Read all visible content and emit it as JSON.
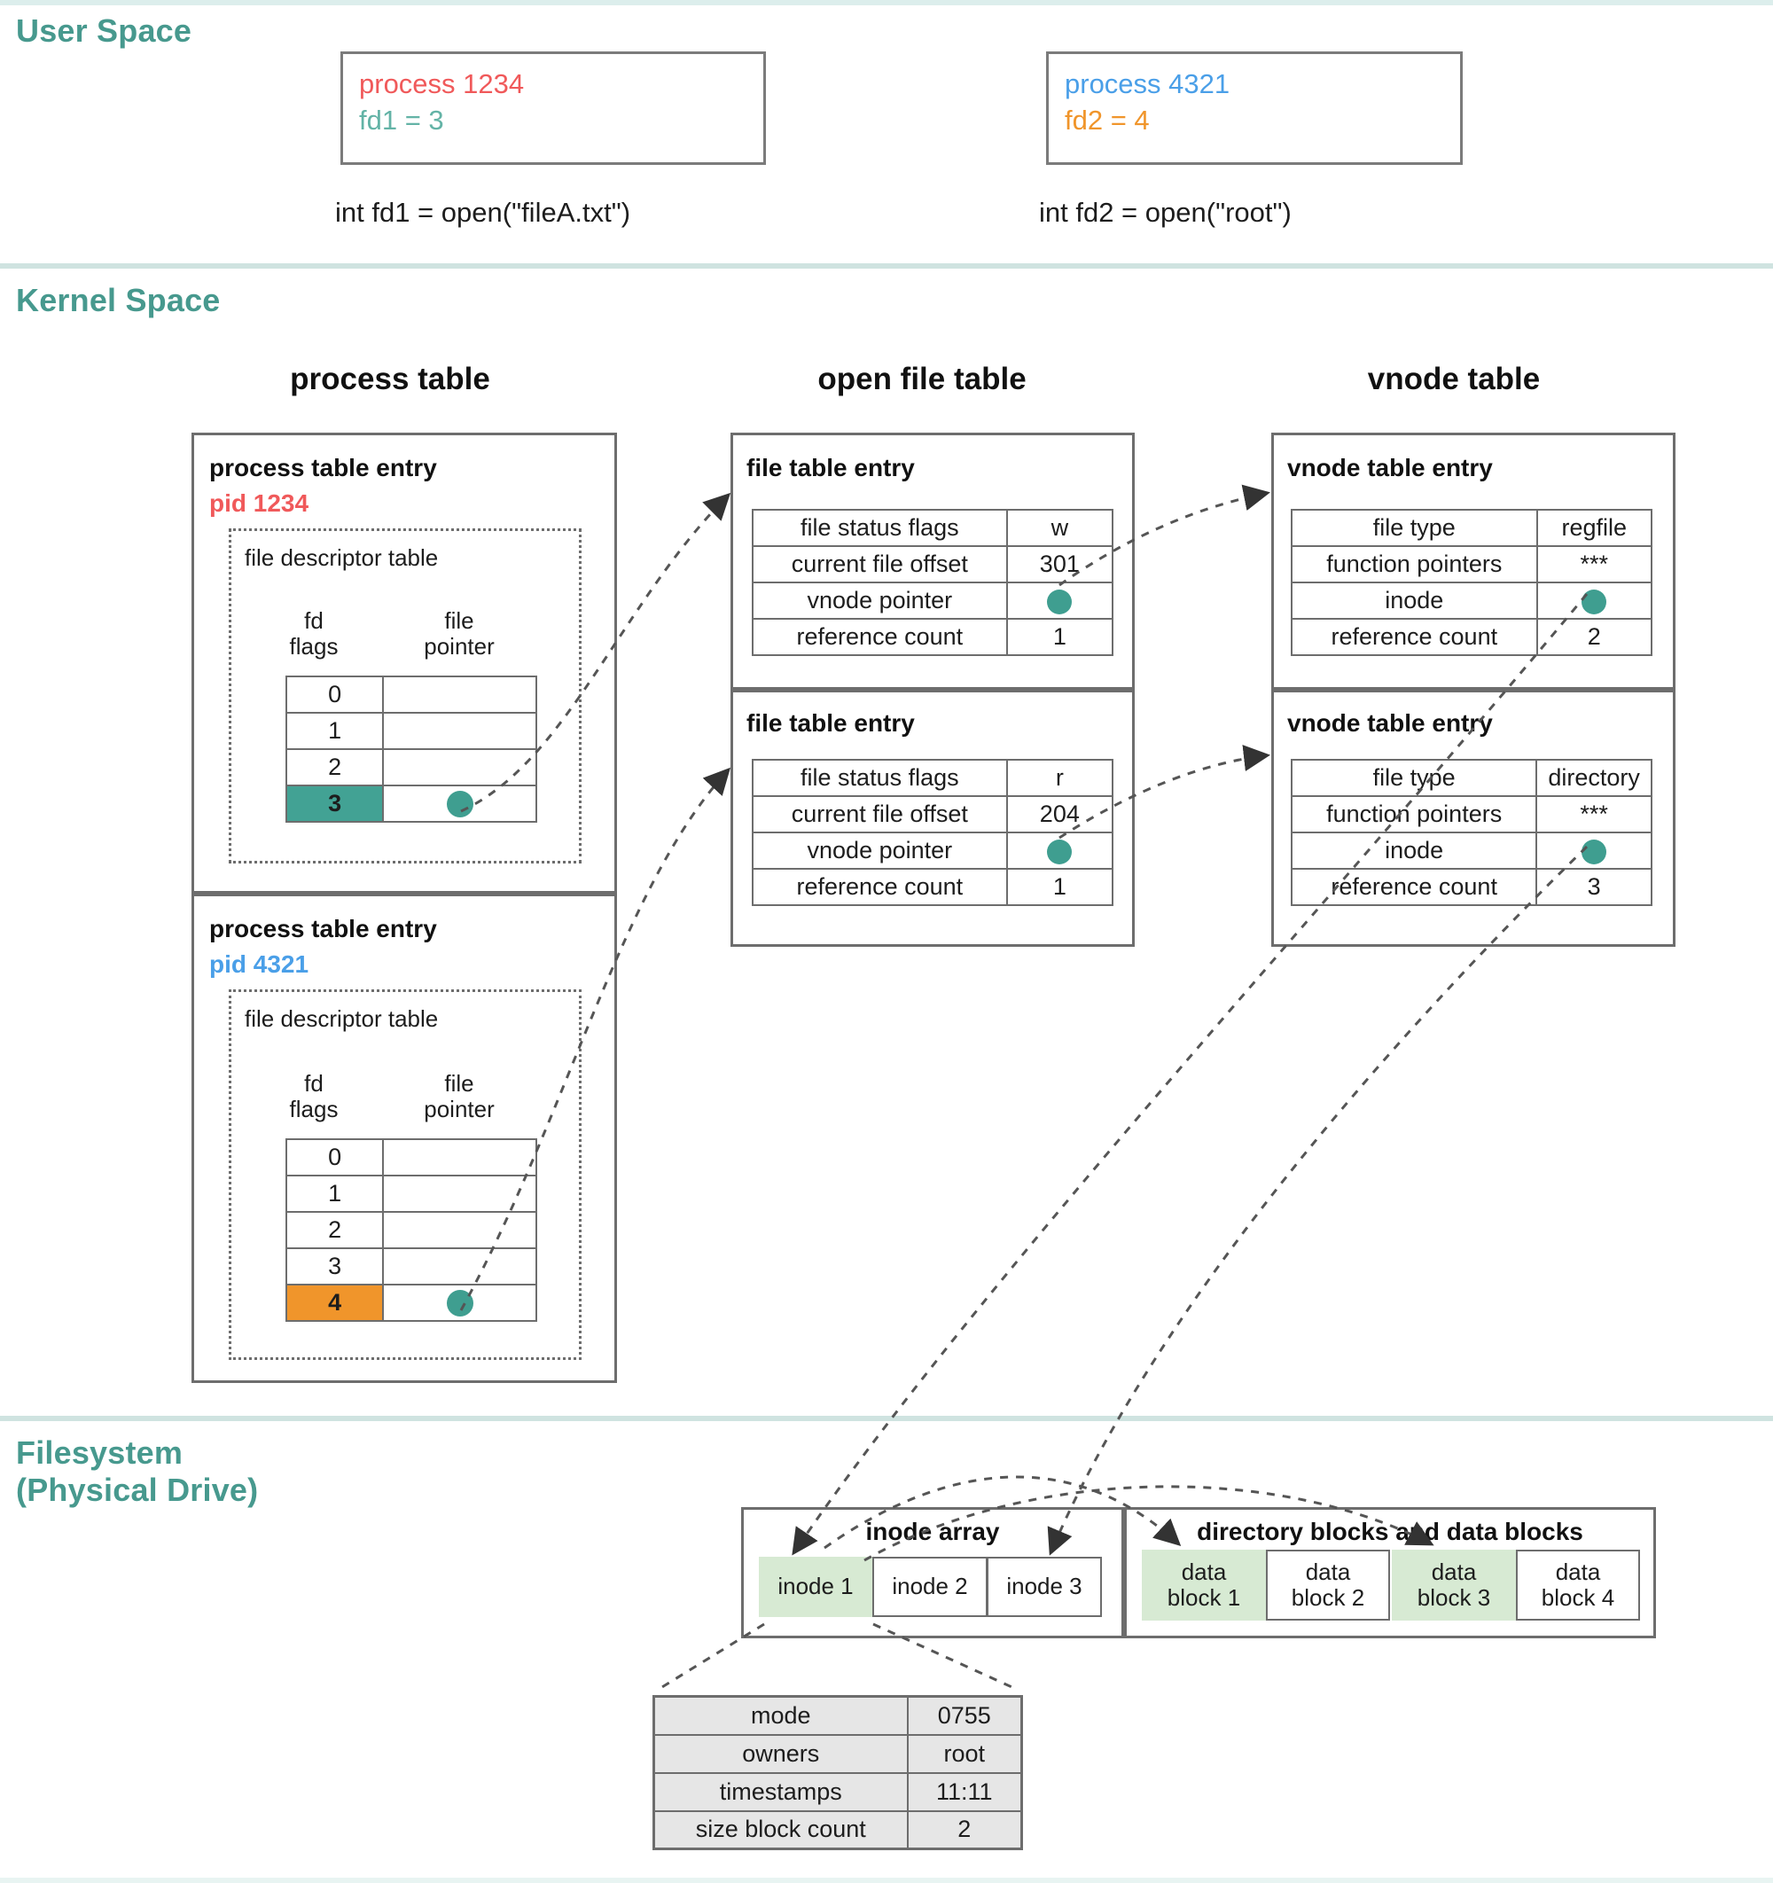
{
  "sections": {
    "user_space": "User Space",
    "kernel_space": "Kernel Space",
    "filesystem": "Filesystem\n(Physical Drive)"
  },
  "colors": {
    "section_title": "#47998e",
    "process1": "#f0595a",
    "process1_fd": "#63b3a6",
    "process2": "#4a9fe8",
    "process2_fd": "#f0952b",
    "highlight_teal": "#42a294",
    "highlight_orange": "#f0952b",
    "pointer_dot": "#3f9e90",
    "green_block": "#d7ead3"
  },
  "user": {
    "processes": [
      {
        "name": "process 1234",
        "fd": "fd1 = 3",
        "call": "int fd1 = open(\"fileA.txt\")"
      },
      {
        "name": "process 4321",
        "fd": "fd2 = 4",
        "call": "int fd2 = open(\"root\")"
      }
    ]
  },
  "kernel": {
    "headings": {
      "process_table": "process table",
      "open_file_table": "open file table",
      "vnode_table": "vnode table"
    },
    "process_entries": [
      {
        "title": "process table entry",
        "pid": "pid 1234",
        "fdt_title": "file descriptor table",
        "col_fd": "fd\nflags",
        "col_ptr": "file\npointer",
        "rows": [
          {
            "fd": "0",
            "ptr": "",
            "highlight": "none"
          },
          {
            "fd": "1",
            "ptr": "",
            "highlight": "none"
          },
          {
            "fd": "2",
            "ptr": "",
            "highlight": "none"
          },
          {
            "fd": "3",
            "ptr": "dot",
            "highlight": "teal"
          }
        ]
      },
      {
        "title": "process table entry",
        "pid": "pid 4321",
        "fdt_title": "file descriptor table",
        "col_fd": "fd\nflags",
        "col_ptr": "file\npointer",
        "rows": [
          {
            "fd": "0",
            "ptr": "",
            "highlight": "none"
          },
          {
            "fd": "1",
            "ptr": "",
            "highlight": "none"
          },
          {
            "fd": "2",
            "ptr": "",
            "highlight": "none"
          },
          {
            "fd": "3",
            "ptr": "",
            "highlight": "none"
          },
          {
            "fd": "4",
            "ptr": "dot",
            "highlight": "orange"
          }
        ]
      }
    ],
    "file_table_entries": [
      {
        "title": "file table entry",
        "rows": [
          {
            "key": "file status flags",
            "value": "w"
          },
          {
            "key": "current file offset",
            "value": "301"
          },
          {
            "key": "vnode pointer",
            "value": "dot"
          },
          {
            "key": "reference count",
            "value": "1"
          }
        ]
      },
      {
        "title": "file table entry",
        "rows": [
          {
            "key": "file status flags",
            "value": "r"
          },
          {
            "key": "current file offset",
            "value": "204"
          },
          {
            "key": "vnode pointer",
            "value": "dot"
          },
          {
            "key": "reference count",
            "value": "1"
          }
        ]
      }
    ],
    "vnode_entries": [
      {
        "title": "vnode table entry",
        "rows": [
          {
            "key": "file type",
            "value": "regfile"
          },
          {
            "key": "function pointers",
            "value": "***"
          },
          {
            "key": "inode",
            "value": "dot"
          },
          {
            "key": "reference count",
            "value": "2"
          }
        ]
      },
      {
        "title": "vnode table entry",
        "rows": [
          {
            "key": "file type",
            "value": "directory"
          },
          {
            "key": "function pointers",
            "value": "***"
          },
          {
            "key": "inode",
            "value": "dot"
          },
          {
            "key": "reference count",
            "value": "3"
          }
        ]
      }
    ]
  },
  "filesystem": {
    "inode_array": {
      "label": "inode array",
      "cells": [
        {
          "text": "inode 1",
          "green": true
        },
        {
          "text": "inode 2",
          "green": false
        },
        {
          "text": "inode 3",
          "green": false
        }
      ]
    },
    "data_blocks": {
      "label": "directory blocks and data blocks",
      "cells": [
        {
          "text": "data\nblock 1",
          "green": true
        },
        {
          "text": "data\nblock 2",
          "green": false
        },
        {
          "text": "data\nblock 3",
          "green": true
        },
        {
          "text": "data\nblock 4",
          "green": false
        }
      ]
    },
    "inode_detail": {
      "rows": [
        {
          "key": "mode",
          "value": "0755"
        },
        {
          "key": "owners",
          "value": "root"
        },
        {
          "key": "timestamps",
          "value": "11:11"
        },
        {
          "key": "size block count",
          "value": "2"
        }
      ]
    }
  }
}
